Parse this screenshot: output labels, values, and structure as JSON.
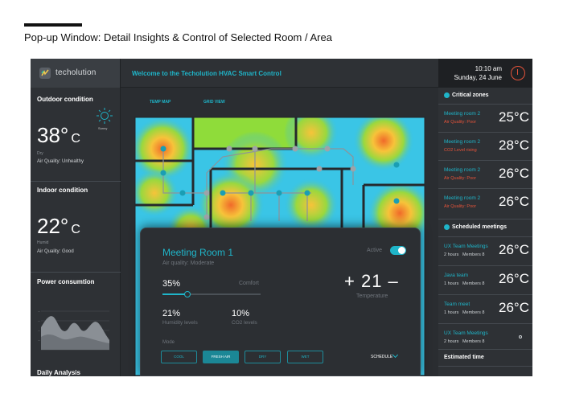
{
  "caption": "Pop-up Window:  Detail Insights & Control of Selected Room / Area",
  "app": {
    "brand": "techolution",
    "welcome": "Welcome to the Techolution HVAC Smart Control",
    "time": "10:10 am",
    "date": "Sunday, 24 June"
  },
  "outdoor": {
    "title": "Outdoor condition",
    "temp": "38°",
    "unit": "C",
    "condition": "Dry",
    "air_quality": "Air Quality: Unhealthy",
    "weather": "Sunny"
  },
  "indoor": {
    "title": "Indoor condition",
    "temp": "22°",
    "unit": "C",
    "condition": "Humid",
    "air_quality": "Air Quality: Good"
  },
  "power": {
    "title": "Power consumtion",
    "daily": "Daily Analysis"
  },
  "map": {
    "tabs": [
      "TEMP MAP",
      "GRID VIEW"
    ]
  },
  "popup": {
    "title": "Meeting Room 1",
    "air_quality": "Air quality: Moderate",
    "active_label": "Active",
    "active": true,
    "comfort_pct": "35%",
    "comfort_value": 0.25,
    "comfort_label": "Comfort",
    "temperature": "+ 21 –",
    "temperature_label": "Temperature",
    "humidity": "21%",
    "humidity_label": "Humidity levels",
    "co2": "10%",
    "co2_label": "CO2 levels",
    "mode_label": "Mode",
    "modes": [
      "COOL",
      "FRESH AIR",
      "DRY",
      "WET"
    ],
    "active_mode": "FRESH AIR",
    "schedule": "SCHEDULE"
  },
  "critical": {
    "title": "Critical zones",
    "items": [
      {
        "name": "Meeting room 2",
        "sub": "Air Quality: Poor",
        "value": "25°C"
      },
      {
        "name": "Meeting room 2",
        "sub": "CO2 Level rising",
        "value": "28°C"
      },
      {
        "name": "Meeting room 2",
        "sub": "Air Quality: Poor",
        "value": "26°C"
      },
      {
        "name": "Meeting room 2",
        "sub": "Air Quality: Poor",
        "value": "26°C"
      }
    ]
  },
  "meetings": {
    "title": "Scheduled meetings",
    "items": [
      {
        "name": "UX Team Meetings",
        "duration": "2 hours",
        "members": "Members 8",
        "value": "26°C"
      },
      {
        "name": "Java team",
        "duration": "1 hours",
        "members": "Members 8",
        "value": "26°C"
      },
      {
        "name": "Team meet",
        "duration": "1 hours",
        "members": "Members 8",
        "value": "26°C"
      },
      {
        "name": "UX Team Meetings",
        "duration": "2 hours",
        "members": "Members 8",
        "value": ""
      }
    ]
  },
  "estimated": {
    "title": "Estimated time"
  },
  "colors": {
    "accent": "#1fb5c9",
    "warning": "#e4533a",
    "panel": "#2e3135"
  }
}
